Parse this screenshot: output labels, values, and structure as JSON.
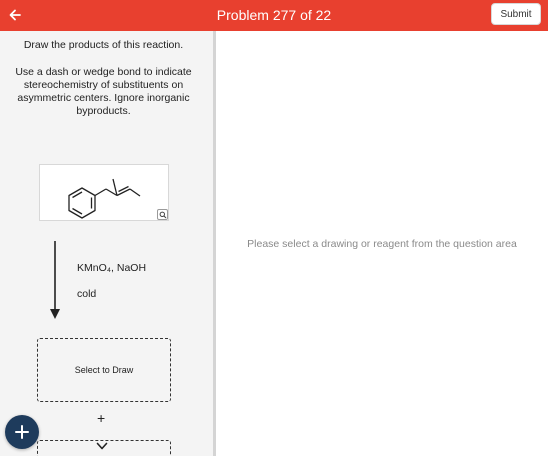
{
  "header": {
    "title": "Problem 277 of 22",
    "submit_label": "Submit",
    "back_icon": "arrow-left-icon",
    "background": "#e8402f"
  },
  "question": {
    "line1": "Draw the products of this reaction.",
    "line2": "Use a dash or wedge bond to indicate stereochemistry of substituents on asymmetric centers. Ignore inorganic byproducts."
  },
  "reaction": {
    "reagent1": "KMnO₄, NaOH",
    "reagent2": "cold",
    "product_slot_label": "Select to Draw",
    "plus": "+"
  },
  "right_panel": {
    "placeholder": "Please select a drawing or reagent from the question area"
  },
  "fab": {
    "icon": "plus-icon",
    "color": "#1e3b5c"
  }
}
